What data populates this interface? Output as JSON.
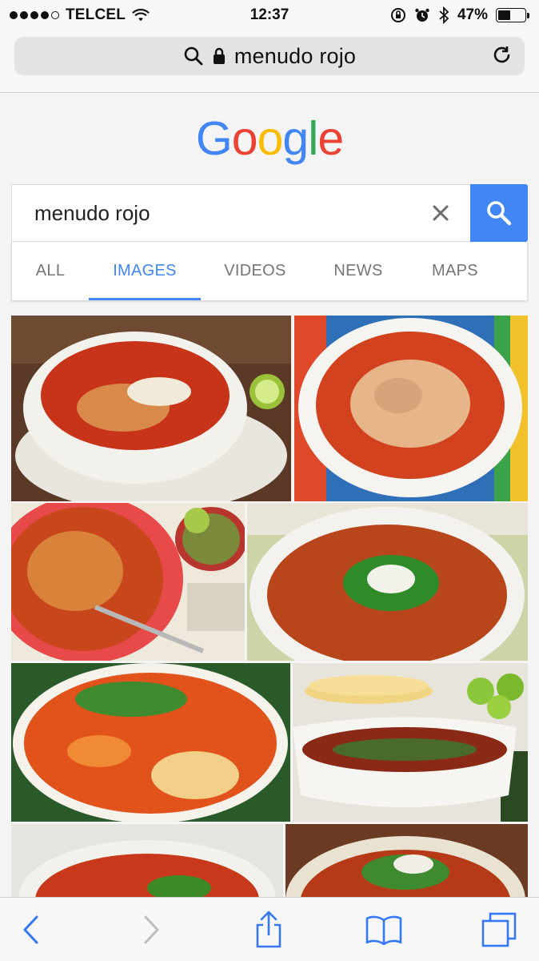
{
  "status_bar": {
    "carrier": "TELCEL",
    "time": "12:37",
    "battery_percent_text": "47%",
    "battery_level": 0.47,
    "signal_bars_filled": 4,
    "signal_bars_total": 5
  },
  "address_bar": {
    "url_text": "menudo rojo",
    "icons": [
      "search-icon",
      "lock-icon",
      "reload-icon"
    ]
  },
  "google": {
    "logo_letters": [
      "G",
      "o",
      "o",
      "g",
      "l",
      "e"
    ],
    "logo_colors": [
      "#4285f4",
      "#ea4335",
      "#fbbc05",
      "#4285f4",
      "#34a853",
      "#ea4335"
    ],
    "search_value": "menudo rojo",
    "tabs": [
      {
        "label": "ALL"
      },
      {
        "label": "IMAGES"
      },
      {
        "label": "VIDEOS"
      },
      {
        "label": "NEWS"
      },
      {
        "label": "MAPS"
      }
    ],
    "active_tab": "IMAGES",
    "accent": "#4285f4"
  },
  "image_results": [
    {
      "subject": "menudo-bowl-with-lime"
    },
    {
      "subject": "menudo-bowl-striped-cloth"
    },
    {
      "subject": "menudo-red-bowl-with-spoon"
    },
    {
      "subject": "menudo-with-cilantro-onion"
    },
    {
      "subject": "menudo-with-hominy"
    },
    {
      "subject": "menudo-with-tortillas-limes"
    },
    {
      "subject": "menudo-bowl"
    },
    {
      "subject": "menudo-bowl"
    }
  ],
  "toolbar": {
    "icons": [
      "back-icon",
      "forward-icon",
      "share-icon",
      "bookmarks-icon",
      "tabs-icon"
    ]
  }
}
